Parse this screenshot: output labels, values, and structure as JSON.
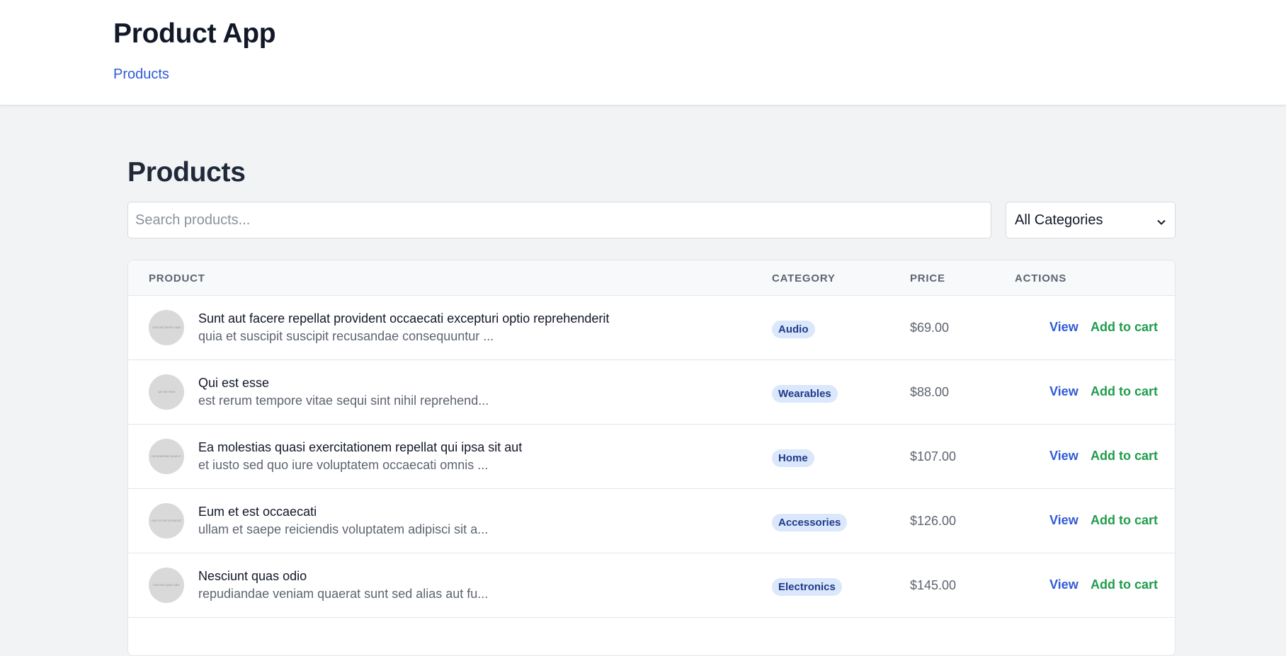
{
  "header": {
    "app_title": "Product App",
    "nav_products": "Products"
  },
  "main": {
    "page_title": "Products",
    "search": {
      "placeholder": "Search products...",
      "value": ""
    },
    "category_filter": {
      "selected": "All Categories"
    }
  },
  "table": {
    "columns": [
      "PRODUCT",
      "CATEGORY",
      "PRICE",
      "ACTIONS"
    ],
    "view_label": "View",
    "cart_label": "Add to cart",
    "rows": [
      {
        "title": "Sunt aut facere repellat provident occaecati excepturi optio reprehenderit",
        "description": "quia et suscipit suscipit recusandae consequuntur ...",
        "thumb_text": "sunt aut facere repe",
        "category": "Audio",
        "price": "$69.00"
      },
      {
        "title": "Qui est esse",
        "description": "est rerum tempore vitae sequi sint nihil reprehend...",
        "thumb_text": "qui est esse",
        "category": "Wearables",
        "price": "$88.00"
      },
      {
        "title": "Ea molestias quasi exercitationem repellat qui ipsa sit aut",
        "description": "et iusto sed quo iure voluptatem occaecati omnis ...",
        "thumb_text": "ea molestias quasi e",
        "category": "Home",
        "price": "$107.00"
      },
      {
        "title": "Eum et est occaecati",
        "description": "ullam et saepe reiciendis voluptatem adipisci sit a...",
        "thumb_text": "eum et est occaecati",
        "category": "Accessories",
        "price": "$126.00"
      },
      {
        "title": "Nesciunt quas odio",
        "description": "repudiandae veniam quaerat sunt sed alias aut fu...",
        "thumb_text": "nesciunt quas odio",
        "category": "Electronics",
        "price": "$145.00"
      }
    ]
  },
  "colors": {
    "link_blue": "#2f5bd8",
    "cart_green": "#1f9d4b",
    "badge_bg": "#dbe7fb",
    "badge_text": "#1e3a8a"
  }
}
